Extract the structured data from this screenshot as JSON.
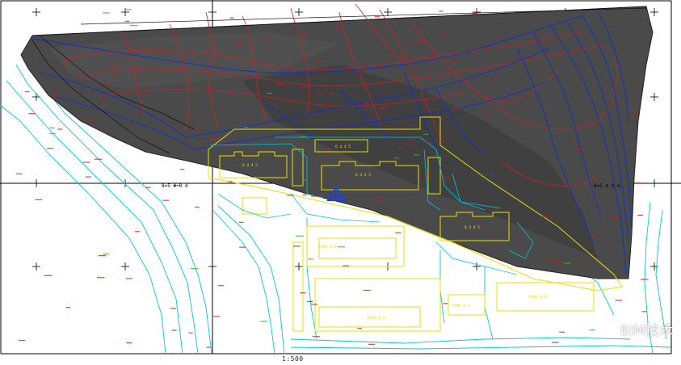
{
  "drawing": {
    "scale_text": "1:500",
    "crosshair_labels": {
      "left": "8=5 4 0 4",
      "right": "8=5 4 0 4"
    },
    "building_labels": [
      "6 4 4 5",
      "6 4 4 5",
      "6 4 4 5",
      "6 4 4 5",
      "BIM6 0 0",
      "BIM6 0 0",
      "BIM6 0 0",
      "BIM6 0 0"
    ]
  },
  "watermark": {
    "text": "BIM技术",
    "icon": "wechat-icon"
  },
  "colors": {
    "terrain": "#4a4a4a",
    "terrain_dark": "#3a3a3a",
    "contour_red": "#d02020",
    "contour_blue": "#1030c8",
    "road_cyan": "#00c8d8",
    "building_yellow": "#e8e000",
    "grid_black": "#000000"
  }
}
